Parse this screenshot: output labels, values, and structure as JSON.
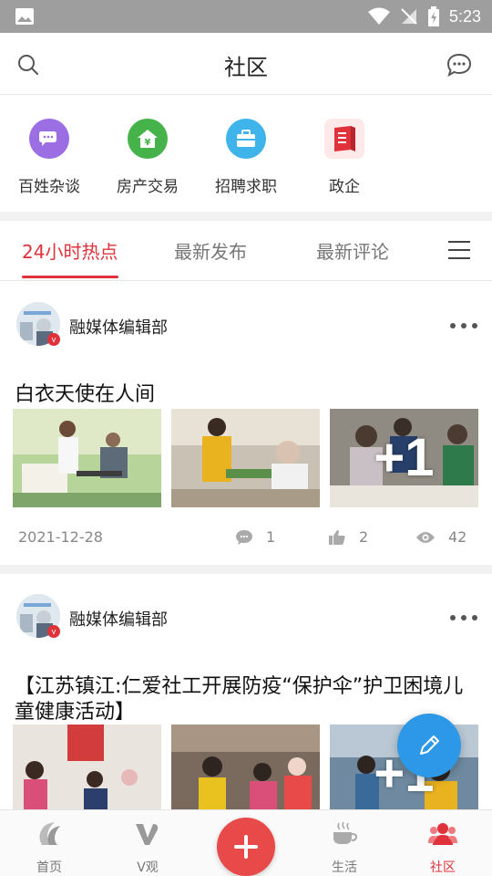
{
  "status_bar": {
    "time": "5:23"
  },
  "header": {
    "title": "社区"
  },
  "categories": [
    {
      "label": "百姓杂谈",
      "icon": "chat-bubbles-icon",
      "color": "#9b6fe3"
    },
    {
      "label": "房产交易",
      "icon": "house-yuan-icon",
      "color": "#46b34a"
    },
    {
      "label": "招聘求职",
      "icon": "briefcase-icon",
      "color": "#3fb4ea"
    },
    {
      "label": "政企",
      "icon": "book-icon",
      "color": "#e0323b"
    }
  ],
  "tabs": [
    {
      "label": "24小时热点",
      "active": true
    },
    {
      "label": "最新发布",
      "active": false
    },
    {
      "label": "最新评论",
      "active": false
    }
  ],
  "posts": [
    {
      "author": "融媒体编辑部",
      "title": "白衣天使在人间",
      "extra_count": "+1",
      "date": "2021-12-28",
      "comments": "1",
      "likes": "2",
      "views": "42"
    },
    {
      "author": "融媒体编辑部",
      "title": "【江苏镇江:仁爱社工开展防疫“保护伞”护卫困境儿童健康活动】",
      "extra_count": "+1"
    }
  ],
  "bottom_nav": [
    {
      "label": "首页",
      "icon": "home-logo-icon",
      "active": false
    },
    {
      "label": "V观",
      "icon": "v-icon",
      "active": false
    },
    {
      "label": "",
      "icon": "plus-icon",
      "active": false
    },
    {
      "label": "生活",
      "icon": "coffee-cup-icon",
      "active": false
    },
    {
      "label": "社区",
      "icon": "community-icon",
      "active": true
    }
  ],
  "colors": {
    "accent": "#e0323b",
    "fab": "#2e98e8"
  }
}
